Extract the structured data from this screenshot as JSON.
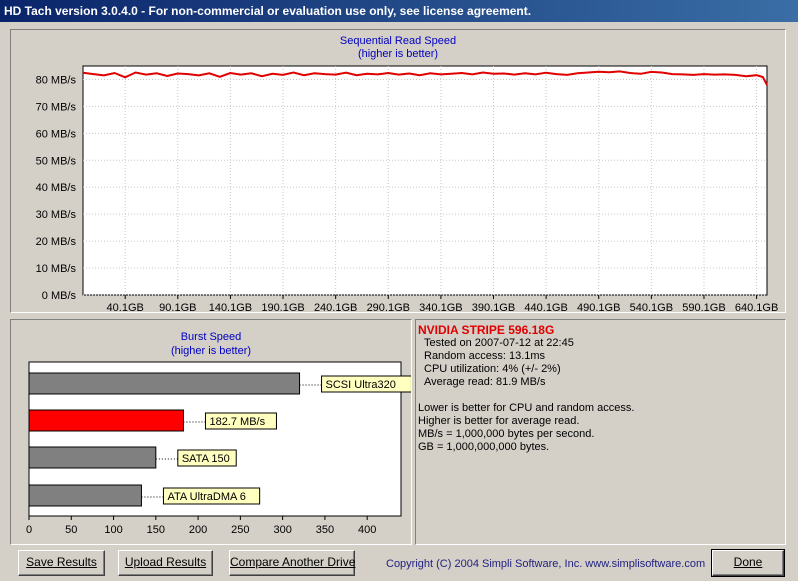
{
  "window": {
    "title": "HD Tach version 3.0.4.0  - For non-commercial or evaluation use only, see license agreement."
  },
  "seq_chart": {
    "title": "Sequential Read Speed",
    "subtitle": "(higher is better)",
    "line_color": "#e00000",
    "y_ticks": [
      "0 MB/s",
      "10 MB/s",
      "20 MB/s",
      "30 MB/s",
      "40 MB/s",
      "50 MB/s",
      "60 MB/s",
      "70 MB/s",
      "80 MB/s"
    ],
    "x_ticks": [
      "40.1GB",
      "90.1GB",
      "140.1GB",
      "190.1GB",
      "240.1GB",
      "290.1GB",
      "340.1GB",
      "390.1GB",
      "440.1GB",
      "490.1GB",
      "540.1GB",
      "590.1GB",
      "640.1GB"
    ]
  },
  "burst_chart": {
    "title": "Burst Speed",
    "subtitle": "(higher is better)",
    "x_ticks": [
      "0",
      "50",
      "100",
      "150",
      "200",
      "250",
      "300",
      "350",
      "400"
    ]
  },
  "chart_data": [
    {
      "type": "line",
      "title": "Sequential Read Speed",
      "subtitle": "(higher is better)",
      "xlabel": "",
      "ylabel": "",
      "xlim": [
        0,
        650
      ],
      "ylim": [
        0,
        85
      ],
      "grid": true,
      "series": [
        {
          "x": [
            0,
            10,
            20,
            30,
            40,
            50,
            60,
            70,
            80,
            90,
            100,
            110,
            120,
            130,
            140,
            150,
            160,
            170,
            180,
            190,
            200,
            210,
            220,
            230,
            240,
            250,
            260,
            270,
            280,
            290,
            300,
            310,
            320,
            330,
            340,
            350,
            360,
            370,
            380,
            390,
            400,
            410,
            420,
            430,
            440,
            450,
            460,
            470,
            480,
            490,
            500,
            510,
            520,
            530,
            540,
            550,
            560,
            570,
            580,
            590,
            600,
            610,
            620,
            630,
            640,
            646,
            650
          ],
          "y": [
            82.5,
            82.0,
            81.5,
            82.4,
            80.8,
            82.6,
            81.8,
            82.3,
            81.3,
            82.2,
            82.0,
            81.5,
            82.3,
            81.0,
            82.4,
            81.8,
            82.3,
            81.2,
            82.1,
            81.7,
            82.6,
            81.6,
            82.3,
            82.0,
            81.8,
            82.5,
            81.6,
            82.1,
            81.9,
            82.4,
            81.8,
            82.2,
            81.6,
            82.3,
            81.9,
            82.1,
            82.4,
            81.9,
            82.6,
            82.1,
            82.2,
            81.8,
            82.3,
            81.9,
            82.5,
            82.0,
            81.7,
            82.3,
            82.6,
            82.9,
            82.7,
            83.0,
            82.4,
            82.1,
            82.8,
            82.6,
            82.0,
            81.9,
            81.7,
            82.0,
            81.8,
            81.9,
            81.7,
            81.2,
            81.6,
            80.9,
            78.0
          ]
        }
      ]
    },
    {
      "type": "bar",
      "title": "Burst Speed",
      "subtitle": "(higher is better)",
      "orientation": "horizontal",
      "categories": [
        "SCSI Ultra320",
        "182.7 MB/s",
        "SATA 150",
        "ATA UltraDMA 6"
      ],
      "values": [
        320,
        182.7,
        150,
        133
      ],
      "colors": [
        "#808080",
        "#ff0000",
        "#808080",
        "#808080"
      ],
      "xlim": [
        0,
        440
      ]
    }
  ],
  "info": {
    "drive_name": "NVIDIA STRIPE 596.18G",
    "tested_on": "Tested on 2007-07-12 at 22:45",
    "random_access": "Random access: 13.1ms",
    "cpu_utilization": "CPU utilization: 4% (+/- 2%)",
    "average_read": "Average read: 81.9 MB/s",
    "note1": "Lower is better for CPU and random access.",
    "note2": "Higher is better for average read.",
    "note3": "MB/s = 1,000,000 bytes per second.",
    "note4": "GB = 1,000,000,000 bytes."
  },
  "buttons": {
    "save": "Save Results",
    "upload": "Upload Results",
    "compare": "Compare Another Drive",
    "done": "Done"
  },
  "copyright": "Copyright (C) 2004 Simpli Software, Inc. www.simplisoftware.com"
}
